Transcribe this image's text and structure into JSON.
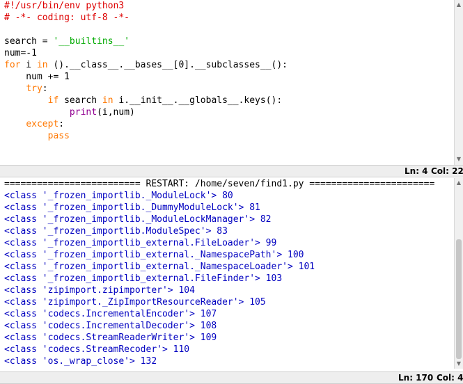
{
  "editor": {
    "lines": [
      [
        {
          "t": "#!/usr/bin/env python3",
          "c": "cmt"
        }
      ],
      [
        {
          "t": "# -*- coding: utf-8 -*-",
          "c": "cmt"
        }
      ],
      [
        {
          "t": "",
          "c": ""
        }
      ],
      [
        {
          "t": "search = ",
          "c": ""
        },
        {
          "t": "'__builtins__'",
          "c": "str"
        }
      ],
      [
        {
          "t": "num=-1",
          "c": ""
        }
      ],
      [
        {
          "t": "for",
          "c": "kw"
        },
        {
          "t": " i ",
          "c": ""
        },
        {
          "t": "in",
          "c": "kw"
        },
        {
          "t": " ().__class__.__bases__[0].__subclasses__():",
          "c": ""
        }
      ],
      [
        {
          "t": "    num += 1",
          "c": ""
        }
      ],
      [
        {
          "t": "    ",
          "c": ""
        },
        {
          "t": "try",
          "c": "kw"
        },
        {
          "t": ":",
          "c": ""
        }
      ],
      [
        {
          "t": "        ",
          "c": ""
        },
        {
          "t": "if",
          "c": "kw"
        },
        {
          "t": " search ",
          "c": ""
        },
        {
          "t": "in",
          "c": "kw"
        },
        {
          "t": " i.__init__.__globals__.keys():",
          "c": ""
        }
      ],
      [
        {
          "t": "            ",
          "c": ""
        },
        {
          "t": "print",
          "c": "bi"
        },
        {
          "t": "(i,num)",
          "c": ""
        }
      ],
      [
        {
          "t": "    ",
          "c": ""
        },
        {
          "t": "except",
          "c": "kw"
        },
        {
          "t": ":",
          "c": ""
        }
      ],
      [
        {
          "t": "        ",
          "c": ""
        },
        {
          "t": "pass",
          "c": "kw"
        }
      ]
    ],
    "status": {
      "ln": "Ln: 4",
      "col": "Col: 22"
    }
  },
  "shell": {
    "lines": [
      "========================= RESTART: /home/seven/find1.py =======================",
      "<class '_frozen_importlib._ModuleLock'> 80",
      "<class '_frozen_importlib._DummyModuleLock'> 81",
      "<class '_frozen_importlib._ModuleLockManager'> 82",
      "<class '_frozen_importlib.ModuleSpec'> 83",
      "<class '_frozen_importlib_external.FileLoader'> 99",
      "<class '_frozen_importlib_external._NamespacePath'> 100",
      "<class '_frozen_importlib_external._NamespaceLoader'> 101",
      "<class '_frozen_importlib_external.FileFinder'> 103",
      "<class 'zipimport.zipimporter'> 104",
      "<class 'zipimport._ZipImportResourceReader'> 105",
      "<class 'codecs.IncrementalEncoder'> 107",
      "<class 'codecs.IncrementalDecoder'> 108",
      "<class 'codecs.StreamReaderWriter'> 109",
      "<class 'codecs.StreamRecoder'> 110",
      "<class 'os._wrap_close'> 132"
    ],
    "status": {
      "ln": "Ln: 170",
      "col": "Col: 4"
    }
  },
  "colors": {
    "keyword": "#ff7700",
    "string": "#00aa00",
    "comment": "#dd0000",
    "builtin": "#900090",
    "output": "#0000c0"
  }
}
